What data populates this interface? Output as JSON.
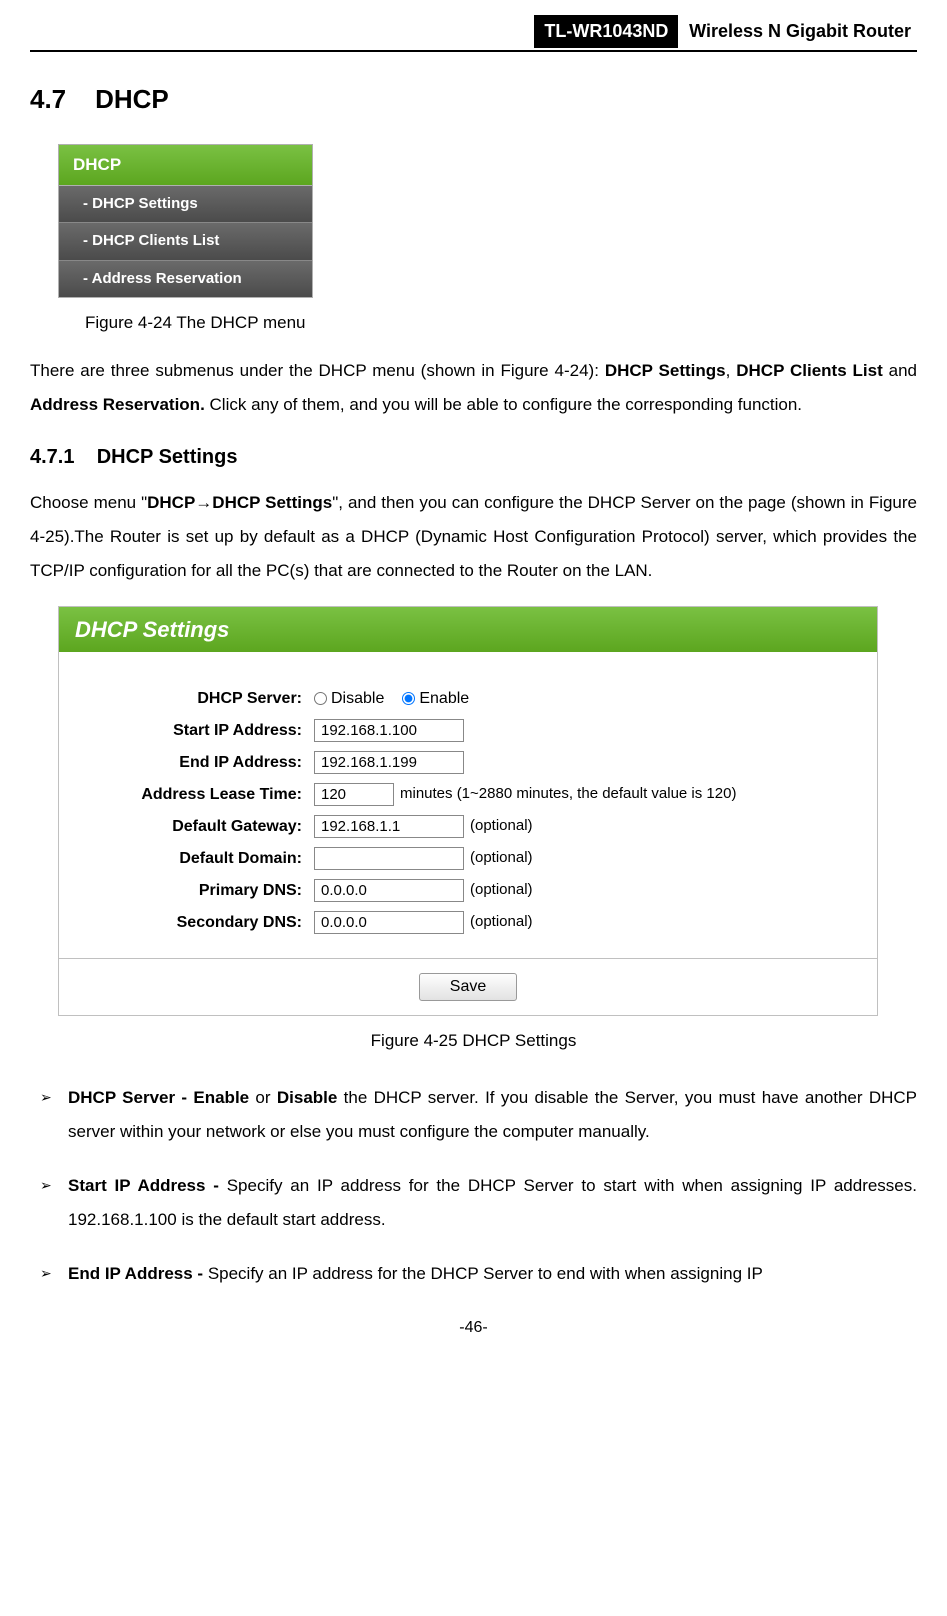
{
  "header": {
    "model": "TL-WR1043ND",
    "product": "Wireless N Gigabit Router"
  },
  "section": {
    "number": "4.7",
    "title": "DHCP"
  },
  "sidemenu": {
    "header": "DHCP",
    "items": [
      "- DHCP Settings",
      "- DHCP Clients List",
      "- Address Reservation"
    ]
  },
  "fig24_caption": "Figure 4-24    The DHCP menu",
  "intro": {
    "line1_pre": "There are three submenus under the DHCP menu (shown in ",
    "fig_ref": "Figure 4-24",
    "line1_mid": "): ",
    "bold1": "DHCP Settings",
    "comma": ", ",
    "bold2": "DHCP Clients List",
    "and": " and ",
    "bold3": "Address Reservation.",
    "line1_end": " Click any of them, and you will be able to configure the corresponding function."
  },
  "subsection": {
    "number": "4.7.1",
    "title": "DHCP Settings"
  },
  "subsection_text": {
    "pre": "Choose menu \"",
    "path_bold": "DHCP→DHCP Settings",
    "mid1": "\", and then you can configure the DHCP Server on the page (shown in ",
    "fig_ref": "Figure 4-25",
    "mid2": ").The Router is set up by default as a DHCP (Dynamic Host Configuration Protocol) server, which provides the TCP/IP configuration for all the PC(s) that are connected to the Router on the LAN."
  },
  "panel": {
    "title": "DHCP Settings",
    "rows": {
      "dhcp_server_label": "DHCP Server:",
      "disable": "Disable",
      "enable": "Enable",
      "start_ip_label": "Start IP Address:",
      "start_ip_value": "192.168.1.100",
      "end_ip_label": "End IP Address:",
      "end_ip_value": "192.168.1.199",
      "lease_label": "Address Lease Time:",
      "lease_value": "120",
      "lease_hint": "minutes (1~2880 minutes, the default value is 120)",
      "gateway_label": "Default Gateway:",
      "gateway_value": "192.168.1.1",
      "optional": "(optional)",
      "domain_label": "Default Domain:",
      "domain_value": "",
      "pdns_label": "Primary DNS:",
      "pdns_value": "0.0.0.0",
      "sdns_label": "Secondary DNS:",
      "sdns_value": "0.0.0.0"
    },
    "save": "Save"
  },
  "fig25_caption": "Figure 4-25    DHCP Settings",
  "bullets": [
    {
      "b1": "DHCP Server - Enable",
      "t1": " or ",
      "b2": "Disable",
      "t2": " the DHCP server. If you disable the Server, you must have another DHCP server within your network or else you must configure the computer manually."
    },
    {
      "b1": "Start IP Address - ",
      "t1": "Specify an IP address for the DHCP Server to start with when assigning IP addresses. 192.168.1.100 is the default start address.",
      "b2": "",
      "t2": ""
    },
    {
      "b1": "End IP Address - ",
      "t1": "Specify an IP address for the DHCP Server to end with when assigning IP",
      "b2": "",
      "t2": ""
    }
  ],
  "page_number": "-46-"
}
